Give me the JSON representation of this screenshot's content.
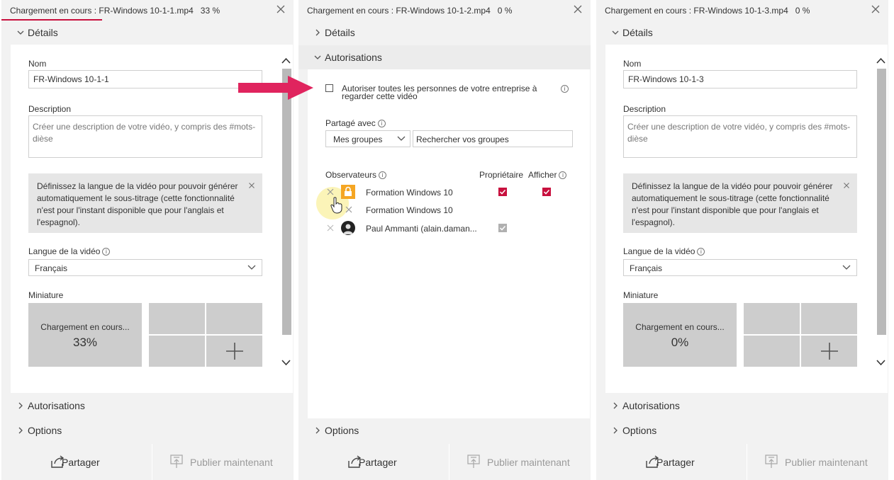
{
  "colors": {
    "accent": "#c8103e",
    "lock": "#f5a623",
    "panel_bg": "#f2f2f2"
  },
  "panels": [
    {
      "title": "Chargement en cours : FR-Windows 10-1-1.mp4",
      "progress_text": "33 %",
      "progress": 0.33,
      "details_label": "Détails",
      "name_label": "Nom",
      "name_value": "FR-Windows 10-1-1",
      "description_label": "Description",
      "description_placeholder": "Créer une description de votre vidéo, y compris des #mots-dièse",
      "info_text": "Définissez la langue de la vidéo pour pouvoir générer automatiquement le sous-titrage (cette fonctionnalité n'est pour l'instant disponible que pour l'anglais et l'espagnol).",
      "language_label": "Langue de la vidéo",
      "language_value": "Français",
      "thumbnail_label": "Miniature",
      "thumb_loading": "Chargement en cours...",
      "thumb_percent": "33%",
      "permissions_label": "Autorisations",
      "options_label": "Options",
      "share_label": "Partager",
      "publish_label": "Publier maintenant"
    },
    {
      "title": "Chargement en cours : FR-Windows 10-1-2.mp4",
      "progress_text": "0 %",
      "progress": 0,
      "details_label": "Détails",
      "permissions_label": "Autorisations",
      "allow_all_text": "Autoriser toutes les personnes de votre entreprise à regarder cette vidéo",
      "shared_with_label": "Partagé avec",
      "groups_select": "Mes groupes",
      "search_placeholder": "Rechercher vos groupes",
      "observers_label": "Observateurs",
      "owner_col": "Propriétaire",
      "show_col": "Afficher",
      "observers": [
        {
          "name": "Formation Windows 10",
          "icon": "lock-icon",
          "owner": true,
          "show": true
        },
        {
          "name": "Formation Windows 10",
          "icon": "none",
          "owner": false,
          "show": false
        },
        {
          "name": "Paul Ammanti (alain.daman...",
          "icon": "avatar",
          "owner": true,
          "show": false
        }
      ],
      "options_label": "Options",
      "share_label": "Partager",
      "publish_label": "Publier maintenant"
    },
    {
      "title": "Chargement en cours : FR-Windows 10-1-3.mp4",
      "progress_text": "0 %",
      "progress": 0,
      "details_label": "Détails",
      "name_label": "Nom",
      "name_value": "FR-Windows 10-1-3",
      "description_label": "Description",
      "description_placeholder": "Créer une description de votre vidéo, y compris des #mots-dièse",
      "info_text": "Définissez la langue de la vidéo pour pouvoir générer automatiquement le sous-titrage (cette fonctionnalité n'est pour l'instant disponible que pour l'anglais et l'espagnol).",
      "language_label": "Langue de la vidéo",
      "language_value": "Français",
      "thumbnail_label": "Miniature",
      "thumb_loading": "Chargement en cours...",
      "thumb_percent": "0%",
      "permissions_label": "Autorisations",
      "options_label": "Options",
      "share_label": "Partager",
      "publish_label": "Publier maintenant"
    }
  ]
}
